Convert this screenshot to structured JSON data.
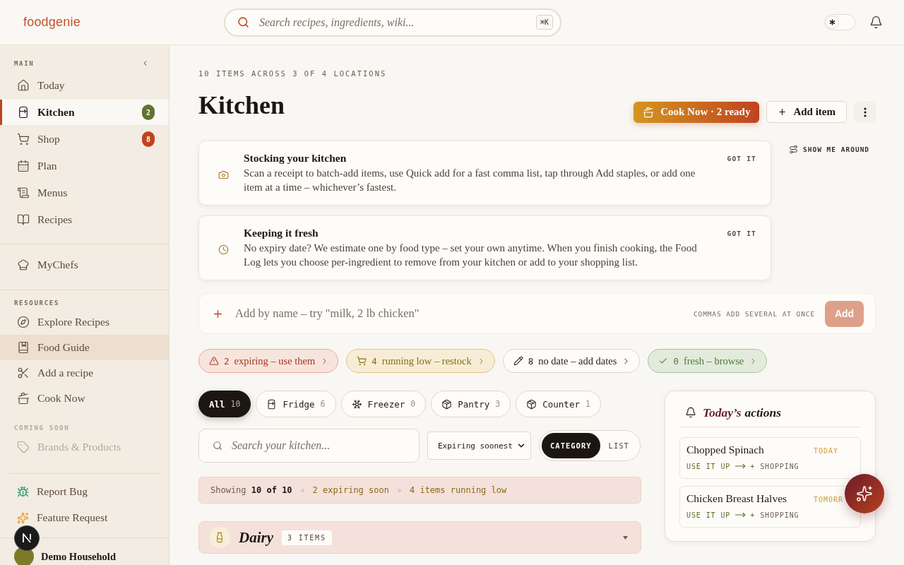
{
  "header": {
    "logo": "foodgenie",
    "search": {
      "placeholder": "Search recipes, ingredients, wiki...",
      "shortcut": "⌘K"
    },
    "theme_toggle": {
      "on": false
    }
  },
  "sidebar": {
    "sections": [
      {
        "title": "MAIN",
        "items": [
          {
            "label": "Today",
            "selected": false,
            "hovered": false,
            "disabled": false
          },
          {
            "label": "Kitchen",
            "selected": true,
            "hovered": false,
            "disabled": false,
            "badge": {
              "count": "2",
              "color": "#5f7332"
            }
          },
          {
            "label": "Shop",
            "selected": false,
            "hovered": false,
            "disabled": false,
            "badge": {
              "count": "8",
              "color": "#c0431f"
            }
          },
          {
            "label": "Plan",
            "selected": false,
            "hovered": false,
            "disabled": false
          },
          {
            "label": "Menus",
            "selected": false,
            "hovered": false,
            "disabled": false
          },
          {
            "label": "Recipes",
            "selected": false,
            "hovered": false,
            "disabled": false
          }
        ]
      },
      {
        "items": [
          {
            "label": "MyChefs",
            "selected": false,
            "hovered": false,
            "disabled": false
          }
        ]
      },
      {
        "title": "RESOURCES",
        "items": [
          {
            "label": "Explore Recipes",
            "selected": false,
            "hovered": false,
            "disabled": false
          },
          {
            "label": "Food Guide",
            "selected": false,
            "hovered": true,
            "disabled": false
          },
          {
            "label": "Add a recipe",
            "selected": false,
            "hovered": false,
            "disabled": false
          },
          {
            "label": "Cook Now",
            "selected": false,
            "hovered": false,
            "disabled": false
          }
        ]
      },
      {
        "title": "COMING SOON",
        "items": [
          {
            "label": "Brands & Products",
            "selected": false,
            "hovered": false,
            "disabled": true
          }
        ]
      }
    ],
    "footer_links": [
      {
        "label": "Report Bug"
      },
      {
        "label": "Feature Request"
      }
    ],
    "household": {
      "name": "Demo Household"
    }
  },
  "page": {
    "eyebrow": "10 ITEMS ACROSS 3 OF 4 LOCATIONS",
    "title": "Kitchen",
    "actions": [
      {
        "kind": "cook",
        "label": "Cook Now · 2 ready"
      },
      {
        "kind": "add",
        "label": "Add item"
      },
      {
        "kind": "more"
      }
    ],
    "tour_link": "SHOW ME AROUND"
  },
  "tips": [
    {
      "title": "Stocking your kitchen",
      "body": "Scan a receipt to batch-add items, use Quick add for a fast comma list, tap through Add staples, or add one item at a time – whichever’s fastest.",
      "dismiss": "GOT IT"
    },
    {
      "title": "Keeping it fresh",
      "body": "No expiry date? We estimate one by food type – set your own anytime. When you finish cooking, the Food Log lets you choose per-ingredient to remove from your kitchen or add to your shopping list.",
      "dismiss": "GOT IT"
    }
  ],
  "quick_add": {
    "placeholder": "Add by name – try \"milk, 2 lb chicken\"",
    "hint": "COMMAS ADD SEVERAL AT ONCE",
    "button": {
      "label": "Add",
      "disabled": true
    }
  },
  "status_chips": [
    {
      "kind": "expiring",
      "count": "2",
      "label": "expiring – use them"
    },
    {
      "kind": "low",
      "count": "4",
      "label": "running low – restock"
    },
    {
      "kind": "nodate",
      "count": "8",
      "label": "no date – add dates"
    },
    {
      "kind": "fresh",
      "count": "0",
      "label": "fresh – browse"
    }
  ],
  "locations": [
    {
      "label": "All",
      "count": "10",
      "selected": true
    },
    {
      "label": "Fridge",
      "count": "6",
      "selected": false
    },
    {
      "label": "Freezer",
      "count": "0",
      "selected": false
    },
    {
      "label": "Pantry",
      "count": "3",
      "selected": false
    },
    {
      "label": "Counter",
      "count": "1",
      "selected": false
    }
  ],
  "filters": {
    "search_placeholder": "Search your kitchen...",
    "sort": "Expiring soonest",
    "view_modes": [
      {
        "label": "CATEGORY",
        "selected": true
      },
      {
        "label": "LIST",
        "selected": false
      }
    ]
  },
  "summary": {
    "showing": "Showing **10 of 10**",
    "notes": [
      "2 expiring soon",
      "4 items running low"
    ]
  },
  "groups": [
    {
      "name": "Dairy",
      "count": "3 ITEMS"
    }
  ],
  "today_actions": {
    "title_accent": "Today’s",
    "title_rest": "actions",
    "items": [
      {
        "name": "Chopped Spinach",
        "due": "TODAY",
        "primary": "USE IT UP",
        "secondary": "+ SHOPPING"
      },
      {
        "name": "Chicken Breast Halves",
        "due": "TOMORR",
        "primary": "USE IT UP",
        "secondary": "+ SHOPPING"
      }
    ]
  }
}
